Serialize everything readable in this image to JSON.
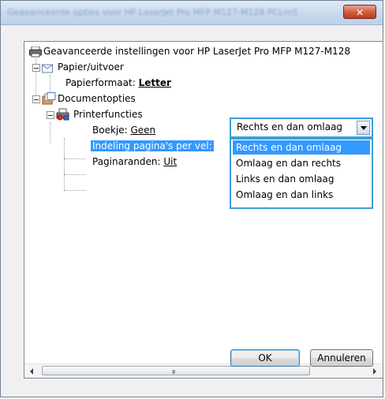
{
  "window": {
    "title": "Geavanceerde opties voor HP LaserJet Pro MFP M127-M128 PCLmS",
    "close_glyph": "✕"
  },
  "tree": {
    "root_label": "Geavanceerde instellingen voor HP LaserJet Pro MFP M127-M128",
    "paper_output_label": "Papier/uitvoer",
    "paper_size_label": "Papierformaat: ",
    "paper_size_value": "Letter",
    "document_options_label": "Documentopties",
    "printer_features_label": "Printerfuncties",
    "booklet_label": "Boekje: ",
    "booklet_value": "Geen",
    "pages_per_sheet_label": "Indeling pagina's per vel:",
    "page_borders_label": "Paginaranden: ",
    "page_borders_value": "Uit"
  },
  "combo": {
    "selected": "Rechts en dan omlaag",
    "options": [
      "Rechts en dan omlaag",
      "Omlaag en dan rechts",
      "Links en dan omlaag",
      "Omlaag en dan links"
    ],
    "highlighted_index": 0
  },
  "scrollbar": {
    "grip_glyph": "III"
  },
  "buttons": {
    "ok_label": "OK",
    "cancel_label": "Annuleren"
  },
  "icons": {
    "printer": "printer-icon",
    "paper": "paper-icon",
    "documents": "documents-icon",
    "printer_features": "printer-features-icon"
  }
}
